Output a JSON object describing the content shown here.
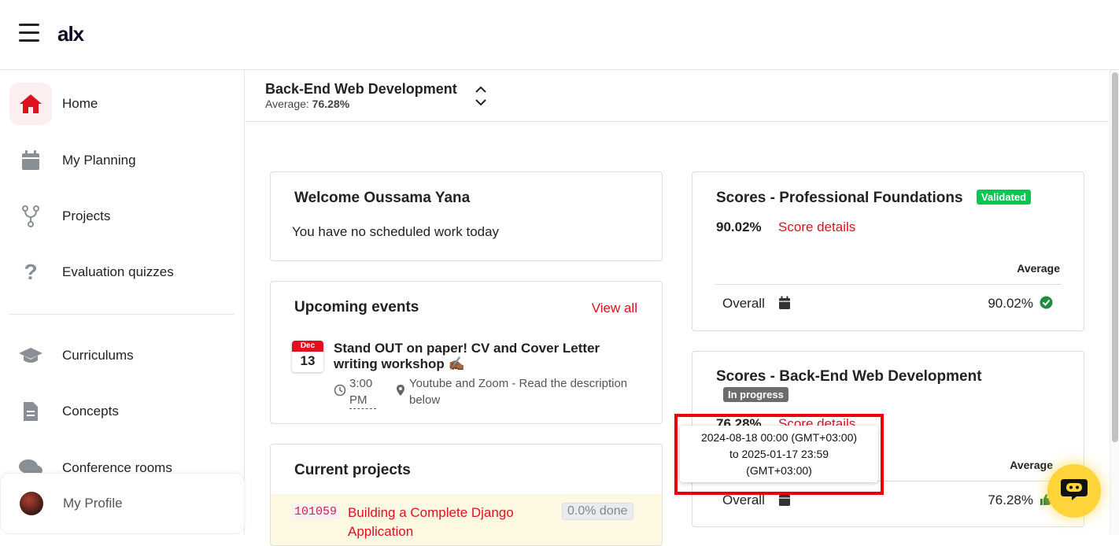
{
  "app": {
    "logo": "alx"
  },
  "sidebar": {
    "items": [
      {
        "label": "Home",
        "icon": "home-icon",
        "active": true
      },
      {
        "label": "My Planning",
        "icon": "calendar-icon"
      },
      {
        "label": "Projects",
        "icon": "fork-icon"
      },
      {
        "label": "Evaluation quizzes",
        "icon": "question-icon"
      },
      {
        "label": "Curriculums",
        "icon": "graduation-cap-icon"
      },
      {
        "label": "Concepts",
        "icon": "document-icon"
      },
      {
        "label": "Conference rooms",
        "icon": "chat-bubbles-icon"
      }
    ],
    "profile": {
      "label": "My Profile"
    }
  },
  "course": {
    "title": "Back-End Web Development",
    "average_label": "Average:",
    "average_value": "76.28%"
  },
  "welcome": {
    "title": "Welcome Oussama Yana",
    "message": "You have no scheduled work today"
  },
  "events": {
    "title": "Upcoming events",
    "view_all": "View all",
    "items": [
      {
        "month": "Dec",
        "day": "13",
        "title": "Stand OUT on paper! CV and Cover Letter writing workshop ✍🏾",
        "time": "3:00 PM",
        "location": "Youtube and Zoom - Read the description below"
      }
    ]
  },
  "projects": {
    "title": "Current projects",
    "items": [
      {
        "id": "101059",
        "name": "Building a Complete Django Application",
        "progress": "0.0% done"
      }
    ]
  },
  "scores_pf": {
    "title": "Scores - Professional Foundations",
    "badge": "Validated",
    "score": "90.02%",
    "details": "Score details",
    "col_header": "Average",
    "row_label": "Overall",
    "row_value": "90.02%"
  },
  "scores_be": {
    "title": "Scores - Back-End Web Development",
    "badge": "In progress",
    "score": "76.28%",
    "details": "Score details",
    "col_header": "Average",
    "row_label": "Overall",
    "row_value": "76.28%"
  },
  "tooltip": {
    "line1": "2024-08-18 00:00 (GMT+03:00)",
    "line2": "to 2025-01-17 23:59",
    "line3": "(GMT+03:00)"
  },
  "colors": {
    "accent": "#e0101f",
    "validated": "#00c853",
    "in_progress": "#6c6c6c",
    "chat": "#ffd43b"
  }
}
